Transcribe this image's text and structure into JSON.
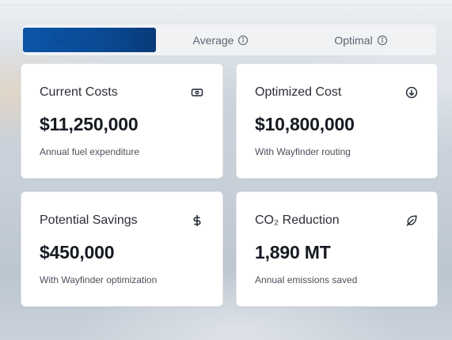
{
  "scenario_tabs": {
    "active_index": 0,
    "items": [
      {
        "label": "Conservative",
        "has_info": true
      },
      {
        "label": "Average",
        "has_info": true
      },
      {
        "label": "Optimal",
        "has_info": true
      }
    ],
    "active_color": "#0a4a94"
  },
  "cards": [
    {
      "title": "Current Costs",
      "value": "$11,250,000",
      "subtitle": "Annual fuel expenditure",
      "icon": "banknote-icon"
    },
    {
      "title": "Optimized Cost",
      "value": "$10,800,000",
      "subtitle": "With Wayfinder routing",
      "icon": "arrow-down-circle-icon"
    },
    {
      "title": "Potential Savings",
      "value": "$450,000",
      "subtitle": "With Wayfinder optimization",
      "icon": "dollar-sign-icon"
    },
    {
      "title": "CO₂ Reduction",
      "value": "1,890 MT",
      "subtitle": "Annual emissions saved",
      "icon": "leaf-icon"
    }
  ]
}
